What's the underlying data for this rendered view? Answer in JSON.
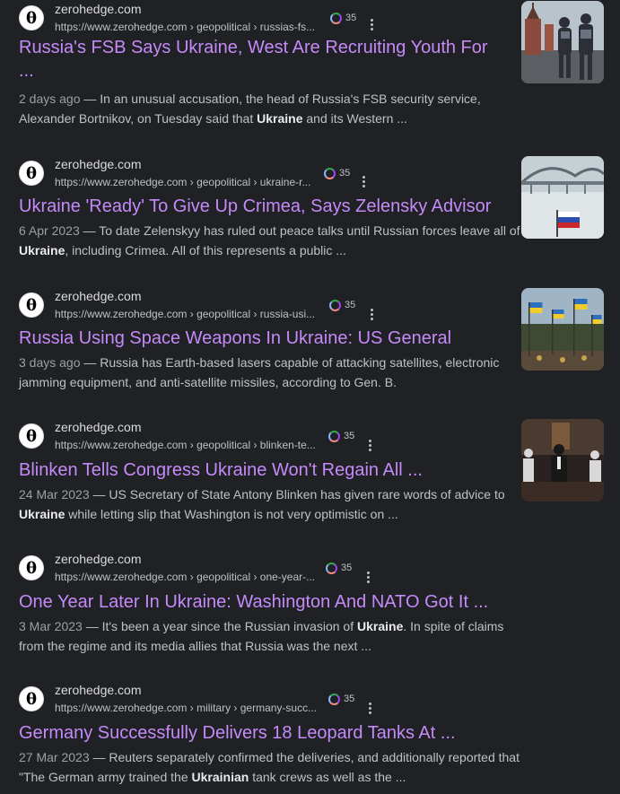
{
  "results": [
    {
      "site": "zerohedge.com",
      "url": "https://www.zerohedge.com › geopolitical › russias-fs...",
      "badge": "35",
      "title_line1": "Russia's FSB Says Ukraine, West Are Recruiting Youth For",
      "title_line2": "...",
      "date": "2 days ago",
      "snippet_pre": " — In an unusual accusation, the head of Russia's FSB security service, Alexander Bortnikov, on Tuesday said that ",
      "snippet_bold": "Ukraine",
      "snippet_post": " and its Western ...",
      "thumb": "kremlin-soldiers"
    },
    {
      "site": "zerohedge.com",
      "url": "https://www.zerohedge.com › geopolitical › ukraine-r...",
      "badge": "35",
      "title_line1": "Ukraine 'Ready' To Give Up Crimea, Says Zelensky Advisor",
      "date": "6 Apr 2023",
      "snippet_pre": " — To date Zelenskyy has ruled out peace talks until Russian forces leave all of ",
      "snippet_bold": "Ukraine",
      "snippet_post": ", including Crimea. All of this represents a public ...",
      "thumb": "crimea-bridge"
    },
    {
      "site": "zerohedge.com",
      "url": "https://www.zerohedge.com › geopolitical › russia-usi...",
      "badge": "35",
      "title_line1": "Russia Using Space Weapons In Ukraine: US General",
      "date": "3 days ago",
      "snippet_pre": " — Russia has Earth-based lasers capable of attacking satellites, electronic jamming equipment, and anti-satellite missiles, according to Gen. B.",
      "snippet_bold": "",
      "snippet_post": "",
      "thumb": "cemetery-flags"
    },
    {
      "site": "zerohedge.com",
      "url": "https://www.zerohedge.com › geopolitical › blinken-te...",
      "badge": "35",
      "title_line1": "Blinken Tells Congress Ukraine Won't Regain All ...",
      "date": "24 Mar 2023",
      "snippet_pre": " — US Secretary of State Antony Blinken has given rare words of advice to ",
      "snippet_bold": "Ukraine",
      "snippet_post": " while letting slip that Washington is not very optimistic on ...",
      "thumb": "blinken-hearing"
    },
    {
      "site": "zerohedge.com",
      "url": "https://www.zerohedge.com › geopolitical › one-year-...",
      "badge": "35",
      "title_line1": "One Year Later In Ukraine: Washington And NATO Got It ...",
      "date": "3 Mar 2023",
      "snippet_pre": " — It's been a year since the Russian invasion of ",
      "snippet_bold": "Ukraine",
      "snippet_post": ". In spite of claims from the regime and its media allies that Russia was the next ...",
      "thumb": ""
    },
    {
      "site": "zerohedge.com",
      "url": "https://www.zerohedge.com › military › germany-succ...",
      "badge": "35",
      "title_line1": "Germany Successfully Delivers 18 Leopard Tanks At ...",
      "date": "27 Mar 2023",
      "snippet_pre": " — Reuters separately confirmed the deliveries, and additionally reported that \"The German army trained the ",
      "snippet_bold": "Ukrainian",
      "snippet_post": " tank crews as well as the ...",
      "thumb": ""
    }
  ],
  "favicon_glyph": "θ",
  "colors": {
    "background": "#202124",
    "title_link": "#c58af9",
    "text": "#bdc1c6"
  }
}
